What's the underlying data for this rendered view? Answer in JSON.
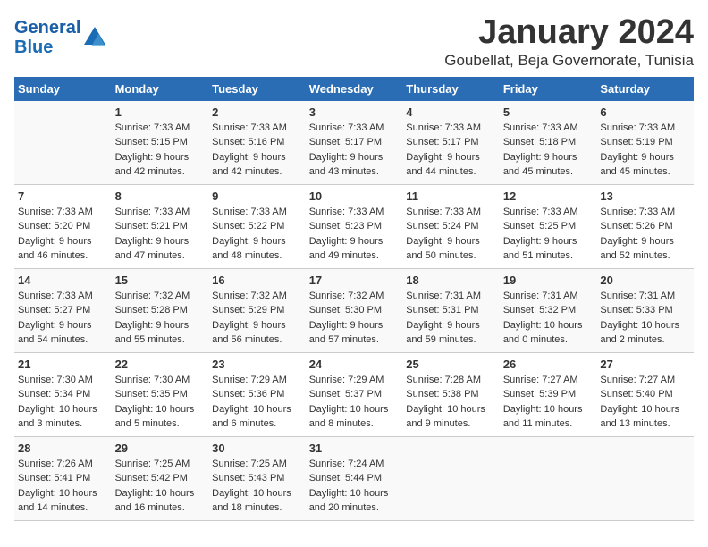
{
  "logo": {
    "line1": "General",
    "line2": "Blue"
  },
  "title": "January 2024",
  "subtitle": "Goubellat, Beja Governorate, Tunisia",
  "days_header": [
    "Sunday",
    "Monday",
    "Tuesday",
    "Wednesday",
    "Thursday",
    "Friday",
    "Saturday"
  ],
  "weeks": [
    [
      {
        "day": "",
        "sunrise": "",
        "sunset": "",
        "daylight": ""
      },
      {
        "day": "1",
        "sunrise": "Sunrise: 7:33 AM",
        "sunset": "Sunset: 5:15 PM",
        "daylight": "Daylight: 9 hours and 42 minutes."
      },
      {
        "day": "2",
        "sunrise": "Sunrise: 7:33 AM",
        "sunset": "Sunset: 5:16 PM",
        "daylight": "Daylight: 9 hours and 42 minutes."
      },
      {
        "day": "3",
        "sunrise": "Sunrise: 7:33 AM",
        "sunset": "Sunset: 5:17 PM",
        "daylight": "Daylight: 9 hours and 43 minutes."
      },
      {
        "day": "4",
        "sunrise": "Sunrise: 7:33 AM",
        "sunset": "Sunset: 5:17 PM",
        "daylight": "Daylight: 9 hours and 44 minutes."
      },
      {
        "day": "5",
        "sunrise": "Sunrise: 7:33 AM",
        "sunset": "Sunset: 5:18 PM",
        "daylight": "Daylight: 9 hours and 45 minutes."
      },
      {
        "day": "6",
        "sunrise": "Sunrise: 7:33 AM",
        "sunset": "Sunset: 5:19 PM",
        "daylight": "Daylight: 9 hours and 45 minutes."
      }
    ],
    [
      {
        "day": "7",
        "sunrise": "Sunrise: 7:33 AM",
        "sunset": "Sunset: 5:20 PM",
        "daylight": "Daylight: 9 hours and 46 minutes."
      },
      {
        "day": "8",
        "sunrise": "Sunrise: 7:33 AM",
        "sunset": "Sunset: 5:21 PM",
        "daylight": "Daylight: 9 hours and 47 minutes."
      },
      {
        "day": "9",
        "sunrise": "Sunrise: 7:33 AM",
        "sunset": "Sunset: 5:22 PM",
        "daylight": "Daylight: 9 hours and 48 minutes."
      },
      {
        "day": "10",
        "sunrise": "Sunrise: 7:33 AM",
        "sunset": "Sunset: 5:23 PM",
        "daylight": "Daylight: 9 hours and 49 minutes."
      },
      {
        "day": "11",
        "sunrise": "Sunrise: 7:33 AM",
        "sunset": "Sunset: 5:24 PM",
        "daylight": "Daylight: 9 hours and 50 minutes."
      },
      {
        "day": "12",
        "sunrise": "Sunrise: 7:33 AM",
        "sunset": "Sunset: 5:25 PM",
        "daylight": "Daylight: 9 hours and 51 minutes."
      },
      {
        "day": "13",
        "sunrise": "Sunrise: 7:33 AM",
        "sunset": "Sunset: 5:26 PM",
        "daylight": "Daylight: 9 hours and 52 minutes."
      }
    ],
    [
      {
        "day": "14",
        "sunrise": "Sunrise: 7:33 AM",
        "sunset": "Sunset: 5:27 PM",
        "daylight": "Daylight: 9 hours and 54 minutes."
      },
      {
        "day": "15",
        "sunrise": "Sunrise: 7:32 AM",
        "sunset": "Sunset: 5:28 PM",
        "daylight": "Daylight: 9 hours and 55 minutes."
      },
      {
        "day": "16",
        "sunrise": "Sunrise: 7:32 AM",
        "sunset": "Sunset: 5:29 PM",
        "daylight": "Daylight: 9 hours and 56 minutes."
      },
      {
        "day": "17",
        "sunrise": "Sunrise: 7:32 AM",
        "sunset": "Sunset: 5:30 PM",
        "daylight": "Daylight: 9 hours and 57 minutes."
      },
      {
        "day": "18",
        "sunrise": "Sunrise: 7:31 AM",
        "sunset": "Sunset: 5:31 PM",
        "daylight": "Daylight: 9 hours and 59 minutes."
      },
      {
        "day": "19",
        "sunrise": "Sunrise: 7:31 AM",
        "sunset": "Sunset: 5:32 PM",
        "daylight": "Daylight: 10 hours and 0 minutes."
      },
      {
        "day": "20",
        "sunrise": "Sunrise: 7:31 AM",
        "sunset": "Sunset: 5:33 PM",
        "daylight": "Daylight: 10 hours and 2 minutes."
      }
    ],
    [
      {
        "day": "21",
        "sunrise": "Sunrise: 7:30 AM",
        "sunset": "Sunset: 5:34 PM",
        "daylight": "Daylight: 10 hours and 3 minutes."
      },
      {
        "day": "22",
        "sunrise": "Sunrise: 7:30 AM",
        "sunset": "Sunset: 5:35 PM",
        "daylight": "Daylight: 10 hours and 5 minutes."
      },
      {
        "day": "23",
        "sunrise": "Sunrise: 7:29 AM",
        "sunset": "Sunset: 5:36 PM",
        "daylight": "Daylight: 10 hours and 6 minutes."
      },
      {
        "day": "24",
        "sunrise": "Sunrise: 7:29 AM",
        "sunset": "Sunset: 5:37 PM",
        "daylight": "Daylight: 10 hours and 8 minutes."
      },
      {
        "day": "25",
        "sunrise": "Sunrise: 7:28 AM",
        "sunset": "Sunset: 5:38 PM",
        "daylight": "Daylight: 10 hours and 9 minutes."
      },
      {
        "day": "26",
        "sunrise": "Sunrise: 7:27 AM",
        "sunset": "Sunset: 5:39 PM",
        "daylight": "Daylight: 10 hours and 11 minutes."
      },
      {
        "day": "27",
        "sunrise": "Sunrise: 7:27 AM",
        "sunset": "Sunset: 5:40 PM",
        "daylight": "Daylight: 10 hours and 13 minutes."
      }
    ],
    [
      {
        "day": "28",
        "sunrise": "Sunrise: 7:26 AM",
        "sunset": "Sunset: 5:41 PM",
        "daylight": "Daylight: 10 hours and 14 minutes."
      },
      {
        "day": "29",
        "sunrise": "Sunrise: 7:25 AM",
        "sunset": "Sunset: 5:42 PM",
        "daylight": "Daylight: 10 hours and 16 minutes."
      },
      {
        "day": "30",
        "sunrise": "Sunrise: 7:25 AM",
        "sunset": "Sunset: 5:43 PM",
        "daylight": "Daylight: 10 hours and 18 minutes."
      },
      {
        "day": "31",
        "sunrise": "Sunrise: 7:24 AM",
        "sunset": "Sunset: 5:44 PM",
        "daylight": "Daylight: 10 hours and 20 minutes."
      },
      {
        "day": "",
        "sunrise": "",
        "sunset": "",
        "daylight": ""
      },
      {
        "day": "",
        "sunrise": "",
        "sunset": "",
        "daylight": ""
      },
      {
        "day": "",
        "sunrise": "",
        "sunset": "",
        "daylight": ""
      }
    ]
  ]
}
